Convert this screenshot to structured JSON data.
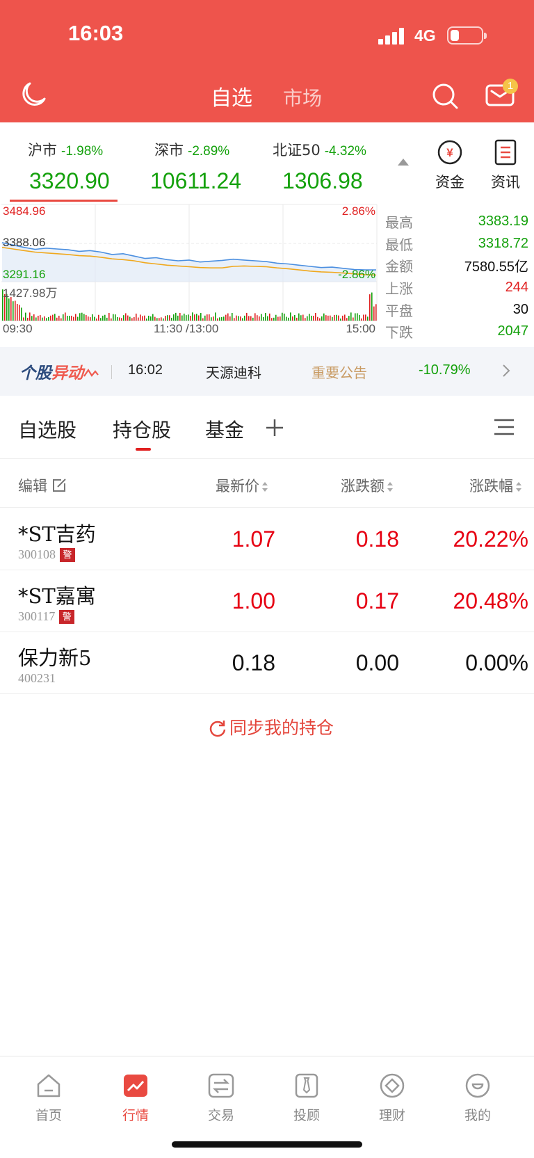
{
  "status_bar": {
    "time": "16:03",
    "network": "4G"
  },
  "header": {
    "tabs": [
      "自选",
      "市场"
    ],
    "icons": [
      "moon-icon",
      "search-icon",
      "mail-icon"
    ],
    "mail_badge": "1"
  },
  "indices": [
    {
      "name": "沪市",
      "change_pct": "-1.98%",
      "value": "3320.90"
    },
    {
      "name": "深市",
      "change_pct": "-2.89%",
      "value": "10611.24"
    },
    {
      "name": "北证50",
      "change_pct": "-4.32%",
      "value": "1306.98"
    }
  ],
  "side_buttons": {
    "fund": "资金",
    "news": "资讯"
  },
  "intraday": {
    "high_label": "3484.96",
    "mid_label": "3388.06",
    "low_label": "3291.16",
    "high_pct": "2.86%",
    "low_pct": "-2.86%",
    "volume_label": "1427.98万",
    "time_start": "09:30",
    "time_mid": "11:30 /13:00",
    "time_end": "15:00",
    "price_series": [
      3390,
      3384,
      3378,
      3373,
      3376,
      3374,
      3372,
      3368,
      3370,
      3366,
      3360,
      3362,
      3356,
      3350,
      3352,
      3347,
      3344,
      3346,
      3341,
      3343,
      3345,
      3348,
      3346,
      3344,
      3342,
      3338,
      3336,
      3333,
      3330,
      3327,
      3328,
      3325,
      3322,
      3321,
      3320.9
    ],
    "avg_series": [
      3378,
      3374,
      3370,
      3366,
      3364,
      3362,
      3360,
      3357,
      3356,
      3353,
      3349,
      3347,
      3344,
      3339,
      3336,
      3333,
      3331,
      3329,
      3327,
      3326,
      3326,
      3330,
      3331,
      3330,
      3329,
      3326,
      3324,
      3321,
      3318,
      3316,
      3315,
      3313,
      3311,
      3309,
      3308
    ]
  },
  "market_stats": [
    {
      "label": "最高",
      "value": "3383.19",
      "color": "#14a10c"
    },
    {
      "label": "最低",
      "value": "3318.72",
      "color": "#14a10c"
    },
    {
      "label": "金额",
      "value": "7580.55亿",
      "color": "#111111"
    },
    {
      "label": "上涨",
      "value": "244",
      "color": "#e02020"
    },
    {
      "label": "平盘",
      "value": "30",
      "color": "#111111"
    },
    {
      "label": "下跌",
      "value": "2047",
      "color": "#14a10c"
    }
  ],
  "alert": {
    "logo_a": "个股",
    "logo_b": "异动",
    "time": "16:02",
    "stock": "天源迪科",
    "type": "重要公告",
    "pct": "-10.79%"
  },
  "watch_tabs": [
    "自选股",
    "持仓股",
    "基金"
  ],
  "table": {
    "edit": "编辑",
    "col_price": "最新价",
    "col_change": "涨跌额",
    "col_pct": "涨跌幅",
    "rows": [
      {
        "name": "*ST吉药",
        "code": "300108",
        "warn": "警",
        "price": "1.07",
        "change": "0.18",
        "pct": "20.22%",
        "color": "#e60012"
      },
      {
        "name": "*ST嘉寓",
        "code": "300117",
        "warn": "警",
        "price": "1.00",
        "change": "0.17",
        "pct": "20.48%",
        "color": "#e60012"
      },
      {
        "name": "保力新5",
        "code": "400231",
        "warn": "",
        "price": "0.18",
        "change": "0.00",
        "pct": "0.00%",
        "color": "#111111"
      }
    ]
  },
  "sync_label": "同步我的持仓",
  "bottom_nav": [
    "首页",
    "行情",
    "交易",
    "投顾",
    "理财",
    "我的"
  ],
  "colors": {
    "brand": "#ee544c",
    "up": "#e60012",
    "down": "#14a10c"
  }
}
